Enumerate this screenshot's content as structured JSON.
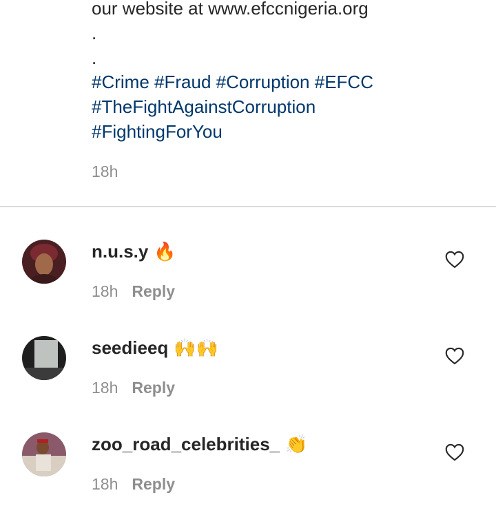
{
  "caption": {
    "lines": [
      "our website at www.efccnigeria.org",
      ".",
      "."
    ],
    "hashtags_line1": [
      "#Crime",
      "#Fraud",
      "#Corruption",
      "#EFCC"
    ],
    "hashtags_line2": "#TheFightAgainstCorruption",
    "hashtags_line3": "#FightingForYou",
    "time": "18h"
  },
  "comments": [
    {
      "username": "n.u.s.y",
      "emoji": "🔥",
      "time": "18h",
      "reply_label": "Reply",
      "avatar_color": "#5a2a2a"
    },
    {
      "username": "seedieeq",
      "emoji": "🙌🙌",
      "time": "18h",
      "reply_label": "Reply",
      "avatar_color": "#2e2e2e"
    },
    {
      "username": "zoo_road_celebrities_",
      "emoji": "👏",
      "time": "18h",
      "reply_label": "Reply",
      "avatar_color": "#c9b89a"
    }
  ],
  "colors": {
    "hashtag": "#00376b",
    "text": "#262626",
    "secondary": "#8e8e8e",
    "divider": "#dbdbdb"
  },
  "icons": {
    "like": "heart-outline-icon"
  }
}
